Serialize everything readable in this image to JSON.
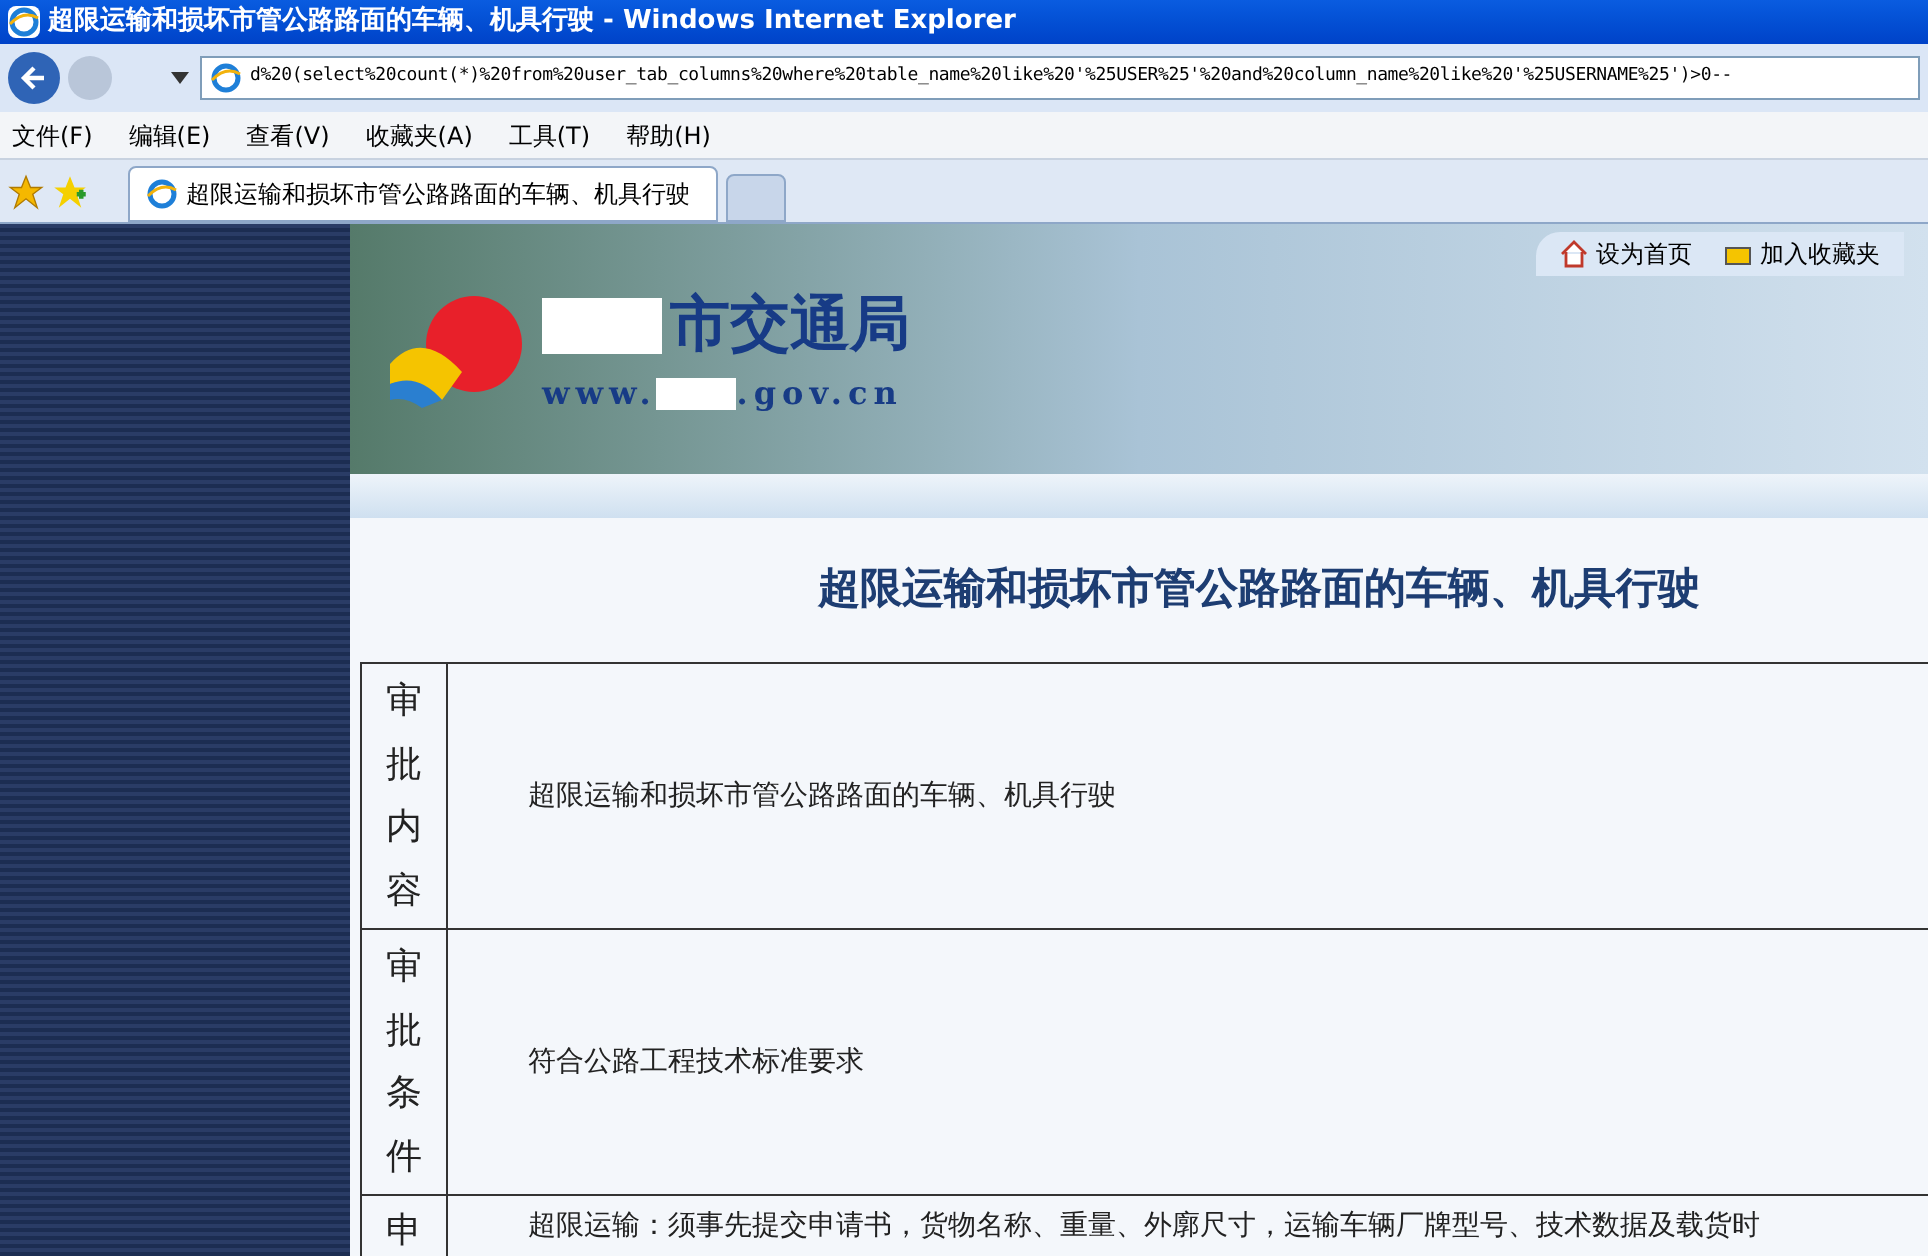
{
  "window": {
    "title": "超限运输和损坏市管公路路面的车辆、机具行驶 - Windows Internet Explorer"
  },
  "address_bar": {
    "value": "d%20(select%20count(*)%20from%20user_tab_columns%20where%20table_name%20like%20'%25USER%25'%20and%20column_name%20like%20'%25USERNAME%25')>0--"
  },
  "menu": [
    "文件(F)",
    "编辑(E)",
    "查看(V)",
    "收藏夹(A)",
    "工具(T)",
    "帮助(H)"
  ],
  "tabs": [
    {
      "label": "超限运输和损坏市管公路路面的车辆、机具行驶",
      "selected": true
    },
    {
      "selected": false
    }
  ],
  "banner": {
    "links": [
      "设为首页",
      "加入收藏夹"
    ],
    "logo_name": "市交通局",
    "logo_url_start": "www.",
    "logo_url_end": ".gov.cn"
  },
  "page_title": "超限运输和损坏市管公路路面的车辆、机具行驶",
  "rows": [
    {
      "label": "审批内容",
      "text": "超限运输和损坏市管公路路面的车辆、机具行驶"
    },
    {
      "label": "审批条件",
      "text": "符合公路工程技术标准要求"
    },
    {
      "label": "申",
      "text": "超限运输：须事先提交申请书，货物名称、重量、外廓尺寸，运输车辆厂牌型号、技术数据及载货时"
    }
  ]
}
